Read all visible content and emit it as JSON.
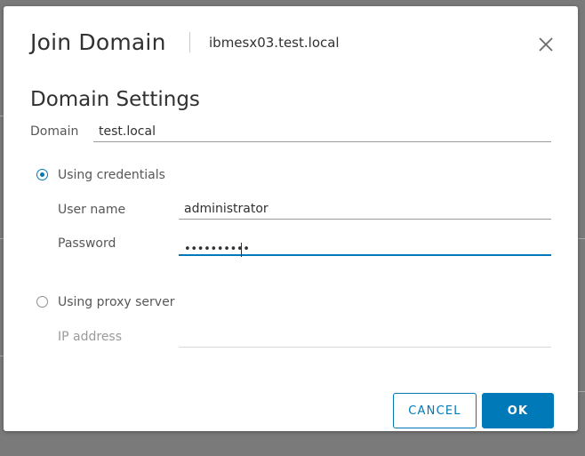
{
  "dialog": {
    "title": "Join Domain",
    "subtitle": "ibmesx03.test.local",
    "close_icon": "close-icon"
  },
  "section": {
    "heading": "Domain Settings"
  },
  "domain": {
    "label": "Domain",
    "value": "test.local"
  },
  "credentials_option": {
    "label": "Using credentials",
    "selected": true,
    "username_label": "User name",
    "username_value": "administrator",
    "password_label": "Password",
    "password_masked": "••••••••••"
  },
  "proxy_option": {
    "label": "Using proxy server",
    "selected": false,
    "ip_label": "IP address",
    "ip_value": ""
  },
  "buttons": {
    "cancel": "CANCEL",
    "ok": "OK"
  },
  "colors": {
    "accent": "#0079b8",
    "text": "#313131",
    "muted": "#9a9a9a"
  }
}
